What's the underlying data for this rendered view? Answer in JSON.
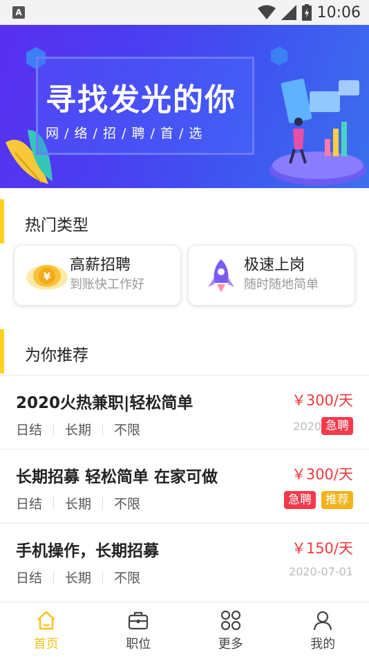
{
  "status_bar": {
    "time": "10:06",
    "app_badge": "A"
  },
  "banner": {
    "title": "寻找发光的你",
    "subtitle": "网 / 络 / 招 / 聘 / 首 / 选"
  },
  "hot_section": {
    "title": "热门类型"
  },
  "categories": [
    {
      "title": "高薪招聘",
      "subtitle": "到账快工作好",
      "icon": "coin-yuan-icon"
    },
    {
      "title": "极速上岗",
      "subtitle": "随时随地简单",
      "icon": "rocket-icon"
    }
  ],
  "recommend_section": {
    "title": "为你推荐"
  },
  "jobs": [
    {
      "title": "2020火热兼职|轻松简单",
      "salary": "￥300/天",
      "tags": [
        "日结",
        "长期",
        "不限"
      ],
      "date": "2020",
      "badges": [
        "急聘"
      ]
    },
    {
      "title": "长期招募 轻松简单 在家可做",
      "salary": "￥300/天",
      "tags": [
        "日结",
        "长期",
        "不限"
      ],
      "date": "",
      "badges": [
        "急聘",
        "推荐"
      ]
    },
    {
      "title": "手机操作，长期招募",
      "salary": "￥150/天",
      "tags": [
        "日结",
        "长期",
        "不限"
      ],
      "date": "2020-07-01",
      "badges": []
    }
  ],
  "bottom_nav": [
    {
      "label": "首页",
      "icon": "home-icon",
      "active": true
    },
    {
      "label": "职位",
      "icon": "briefcase-icon",
      "active": false
    },
    {
      "label": "更多",
      "icon": "grid-more-icon",
      "active": false
    },
    {
      "label": "我的",
      "icon": "user-icon",
      "active": false
    }
  ],
  "colors": {
    "accent": "#f7c21a",
    "price": "#f0393d",
    "urgent": "#f4394b",
    "recommend": "#f3b31a",
    "banner": "#4a3ef0"
  }
}
